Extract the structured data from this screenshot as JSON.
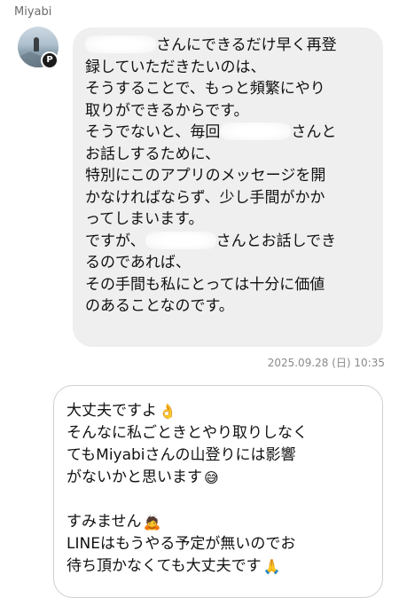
{
  "sender": {
    "name": "Miyabi",
    "badge": "P"
  },
  "incoming": {
    "lines": [
      [
        "",
        "さんにできるだけ早く再登"
      ],
      [
        "録していただきたいのは、"
      ],
      [
        "そうすることで、もっと頻繁にやり"
      ],
      [
        "取りができるからです。"
      ],
      [
        "そうでないと、毎回",
        "さんと"
      ],
      [
        "お話しするために、"
      ],
      [
        "特別にこのアプリのメッセージを開"
      ],
      [
        "かなければならず、少し手間がかか"
      ],
      [
        "ってしまいます。"
      ],
      [
        "ですが、",
        "さんとお話しでき"
      ],
      [
        "るのであれば、"
      ],
      [
        "その手間も私にとっては十分に価値"
      ],
      [
        "のあることなのです。"
      ]
    ]
  },
  "timestamp": "2025.09.28 (日) 10:35",
  "outgoing": {
    "lines": [
      {
        "text": "大丈夫ですよ",
        "emoji": "👌"
      },
      {
        "text": "そんなに私ごときとやり取りしなく"
      },
      {
        "text": "てもMiyabiさんの山登りには影響"
      },
      {
        "text": "がないかと思います",
        "emoji": "😅"
      },
      {
        "text": ""
      },
      {
        "text": "すみません",
        "emoji": "🙇"
      },
      {
        "text": "LINEはもうやる予定が無いのでお"
      },
      {
        "text": "待ち頂かなくても大丈夫です",
        "emoji": "🙏"
      }
    ]
  }
}
